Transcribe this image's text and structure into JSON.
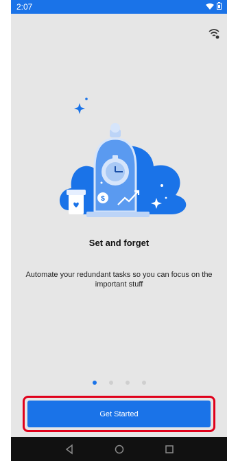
{
  "status_bar": {
    "time": "2:07",
    "icons": [
      "wifi-icon",
      "battery-icon"
    ]
  },
  "onboarding": {
    "title": "Set and forget",
    "description": "Automate your redundant tasks so you can focus on the important stuff",
    "cta_label": "Get Started",
    "page_count": 4,
    "current_page": 1
  },
  "nav_bar": {
    "buttons": [
      "back-icon",
      "home-icon",
      "recents-icon"
    ]
  },
  "colors": {
    "accent": "#1a73e8",
    "highlight": "#e0001b",
    "background": "#e6e6e6"
  }
}
